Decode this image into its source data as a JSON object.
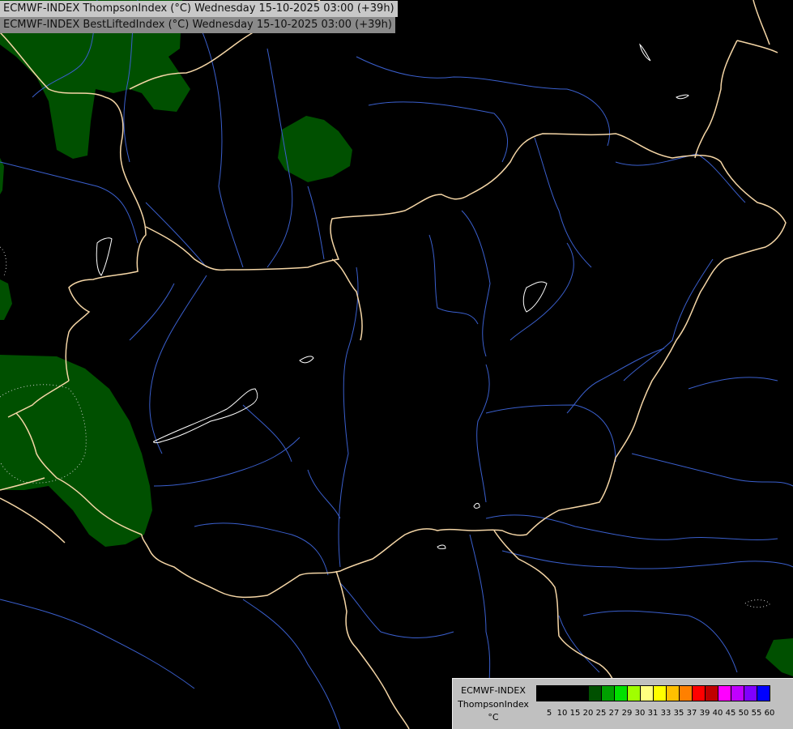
{
  "title_line1": "ECMWF-INDEX ThompsonIndex (°C) Wednesday 15-10-2025 03:00 (+39h)",
  "title_line2": "ECMWF-INDEX BestLiftedIndex (°C) Wednesday 15-10-2025 03:00 (+39h)",
  "legend": {
    "line1": "ECMWF-INDEX",
    "line2": "ThompsonIndex",
    "line3": "°C",
    "colors": [
      "#000000",
      "#000000",
      "#000000",
      "#000000",
      "#005000",
      "#00a000",
      "#00e000",
      "#a0ff00",
      "#ffff80",
      "#ffff00",
      "#ffc000",
      "#ff8000",
      "#ff0000",
      "#c00000",
      "#ff00ff",
      "#c000ff",
      "#8000ff",
      "#0000ff"
    ],
    "ticks": [
      "5",
      "10",
      "15",
      "20",
      "25",
      "27",
      "29",
      "30",
      "31",
      "33",
      "35",
      "37",
      "39",
      "40",
      "45",
      "50",
      "55",
      "60"
    ]
  },
  "colors": {
    "background": "#000000",
    "borders": "#f5d6a6",
    "rivers": "#3a5fcd",
    "lakes": "#ffffff",
    "positive_area": "#005000"
  }
}
